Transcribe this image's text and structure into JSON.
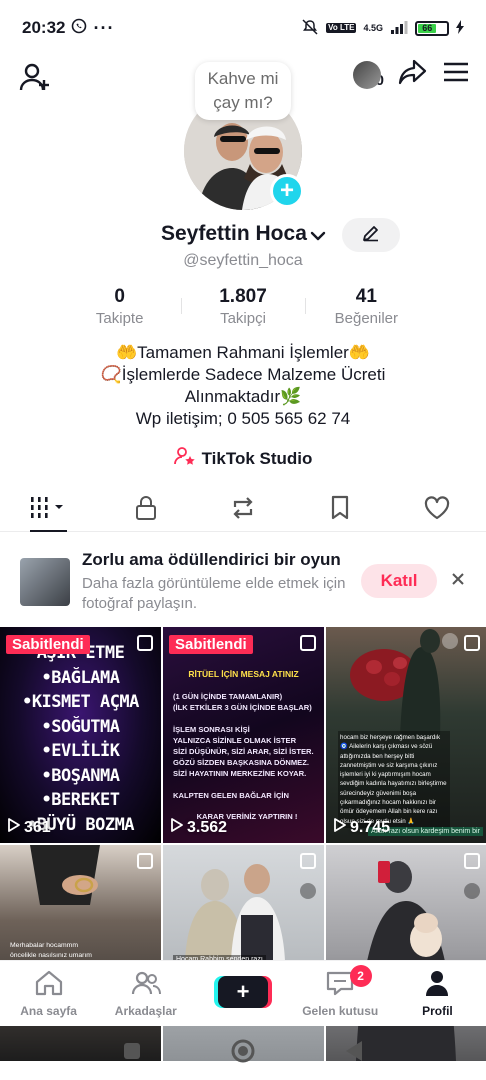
{
  "status_bar": {
    "time": "20:32",
    "network": "4.5G",
    "battery": "66"
  },
  "top_bar": {
    "story_count": "10"
  },
  "profile": {
    "bubble_text": "Kahve mi çay mı?",
    "name": "Seyfettin Hoca",
    "username": "@seyfettin_hoca",
    "stats": [
      {
        "value": "0",
        "label": "Takipte"
      },
      {
        "value": "1.807",
        "label": "Takipçi"
      },
      {
        "value": "41",
        "label": "Beğeniler"
      }
    ],
    "bio": [
      "🤲Tamamen Rahmani İşlemler🤲",
      "📿İşlemlerde Sadece Malzeme Ücreti",
      "Alınmaktadır🌿",
      "Wp iletişim; 0 505 565 62 74"
    ],
    "studio_label": "TikTok Studio"
  },
  "promo": {
    "title": "Zorlu ama ödüllendirici bir oyun",
    "description": "Daha fazla görüntüleme elde etmek için fotoğraf paylaşın.",
    "button": "Katıl"
  },
  "videos": [
    {
      "pinned": "Sabitlendi",
      "views": "361",
      "lines": [
        "AŞIK ETME",
        "•BAĞLAMA",
        "•KISMET AÇMA",
        "•SOĞUTMA",
        "•EVLİLİK",
        "•BOŞANMA",
        "•BEREKET",
        "•BÜYÜ BOZMA"
      ]
    },
    {
      "pinned": "Sabitlendi",
      "views": "3.562",
      "title": "RİTÜEL İÇİN MESAJ ATINIZ",
      "lines": [
        "(1 GÜN İÇİNDE TAMAMLANIR)",
        "(İLK ETKİLER 3 GÜN İÇİNDE BAŞLAR)",
        "",
        "İŞLEM SONRASI KİŞİ",
        "YALNIZCA SİZİNLE OLMAK İSTER",
        "SİZİ DÜŞÜNÜR, SİZİ ARAR, SİZİ İSTER.",
        "GÖZÜ SİZDEN BAŞKASINA DÖNMEZ.",
        "SİZİ HAYATININ MERKEZİNE KOYAR.",
        "",
        "KALPTEN GELEN BAĞLAR İÇİN",
        "KARAR VERİNİZ YAPTIRIN !"
      ]
    },
    {
      "views": "9.745",
      "caption": "hocam biz herşeye rağmen başardık 🧿 Ailelerin karşı çıkması ve sözü attığımızda ben herşey bitti zannetmiştim ve siz karşıma çıkınız işlemleri iyi ki yaptırmışım hocam sevdiğim kadınla hayatımızı birleştirme sürecindeyiz güvenimi boşa çıkarmadığınız hocam hakkınızı bir ömür ödeyemem Allah bin kere razı olsun sizi de mutlu etsin 🙏",
      "footer": "Allah razı olsun kardeşim benim bir"
    },
    {
      "caption": "Merhabalar hocammm öncelikle nasılsınız umarım iyisinizdir ben gözlerime inanamıyorum hocam beni terk eden bırakan son zamanlarda bana kötü"
    },
    {
      "caption": "Hocam Rabbim senden razı"
    },
    {
      "caption": ""
    }
  ],
  "bottom_nav": [
    {
      "label": "Ana sayfa"
    },
    {
      "label": "Arkadaşlar"
    },
    {
      "label": ""
    },
    {
      "label": "Gelen kutusu",
      "badge": "2"
    },
    {
      "label": "Profil"
    }
  ]
}
